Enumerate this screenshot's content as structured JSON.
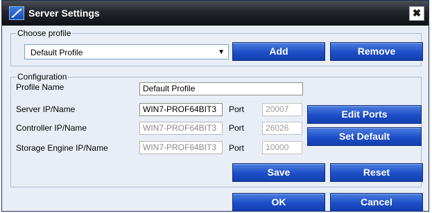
{
  "window": {
    "title": "Server Settings",
    "icon": "app-logo-icon",
    "close_glyph": "✖"
  },
  "choose_profile": {
    "label": "Choose profile",
    "selected": "Default Profile",
    "arrow_glyph": "▼",
    "add_label": "Add",
    "remove_label": "Remove"
  },
  "configuration": {
    "label": "Configuration",
    "profile_name_label": "Profile Name",
    "profile_name_value": "Default Profile",
    "port_label": "Port",
    "rows": [
      {
        "label": "Server IP/Name",
        "value": "WIN7-PROF64BIT3",
        "port": "20007"
      },
      {
        "label": "Controller IP/Name",
        "value": "WIN7-PROF64BIT3",
        "port": "26026"
      },
      {
        "label": "Storage Engine IP/Name",
        "value": "WIN7-PROF64BIT3",
        "port": "10000"
      }
    ],
    "edit_ports_label": "Edit Ports",
    "set_default_label": "Set Default",
    "save_label": "Save",
    "reset_label": "Reset"
  },
  "footer": {
    "ok_label": "OK",
    "cancel_label": "Cancel"
  },
  "colors": {
    "button_blue": "#1d4ec8",
    "titlebar": "#22252b",
    "panel": "#e9eef6"
  }
}
